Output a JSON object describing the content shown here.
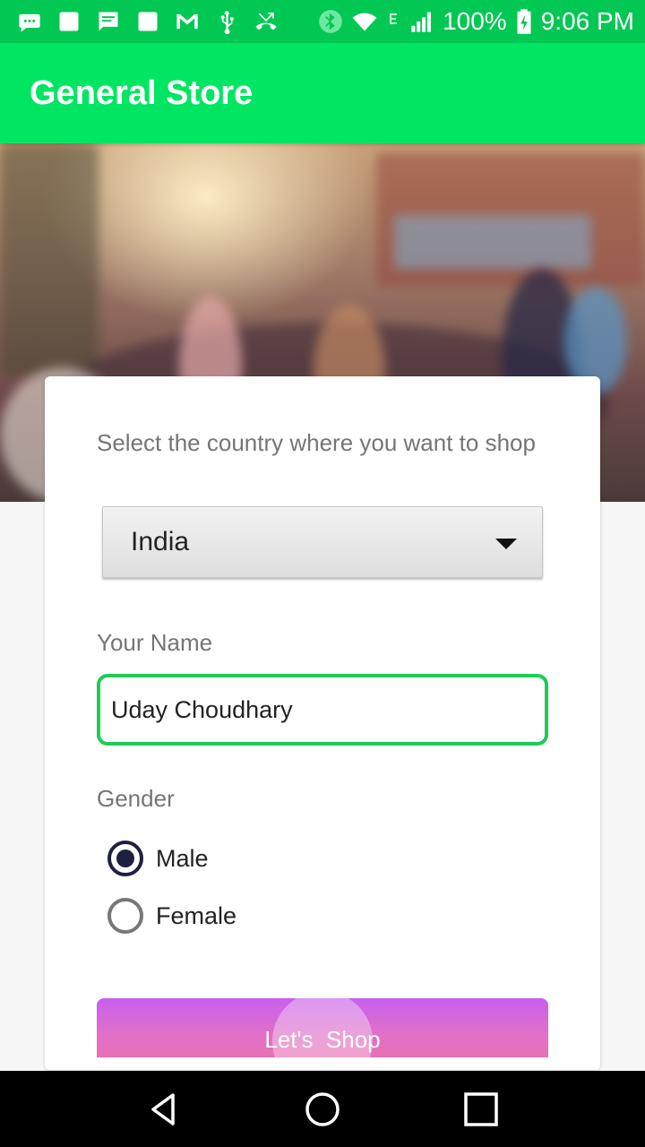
{
  "status_bar": {
    "left_icons": [
      "messaging-icon",
      "notification-square-icon",
      "chat-message-icon",
      "notification-square-icon",
      "gmail-icon",
      "usb-icon",
      "missed-call-icon"
    ],
    "right_icons": [
      "bluetooth-icon",
      "wifi-icon",
      "data-e-icon",
      "signal-icon",
      "battery-charging-icon"
    ],
    "battery": "100%",
    "time": "9:06 PM"
  },
  "app_bar": {
    "title": "General Store"
  },
  "colors": {
    "status_bar": "#00c853",
    "app_bar": "#00e663",
    "input_border": "#1ecb57",
    "radio_checked": "#1f1f3f",
    "button_top": "#c85ff0",
    "button_bottom": "#e870b4"
  },
  "form": {
    "country_label": "Select the country where you want to shop",
    "country_selected": "India",
    "name_label": "Your Name",
    "name_value": "Uday Choudhary",
    "gender_label": "Gender",
    "gender_options": [
      {
        "label": "Male",
        "checked": true
      },
      {
        "label": "Female",
        "checked": false
      }
    ],
    "submit_label": "Let's  Shop"
  },
  "nav_bar": {
    "buttons": [
      "back-icon",
      "home-icon",
      "recents-icon"
    ]
  }
}
